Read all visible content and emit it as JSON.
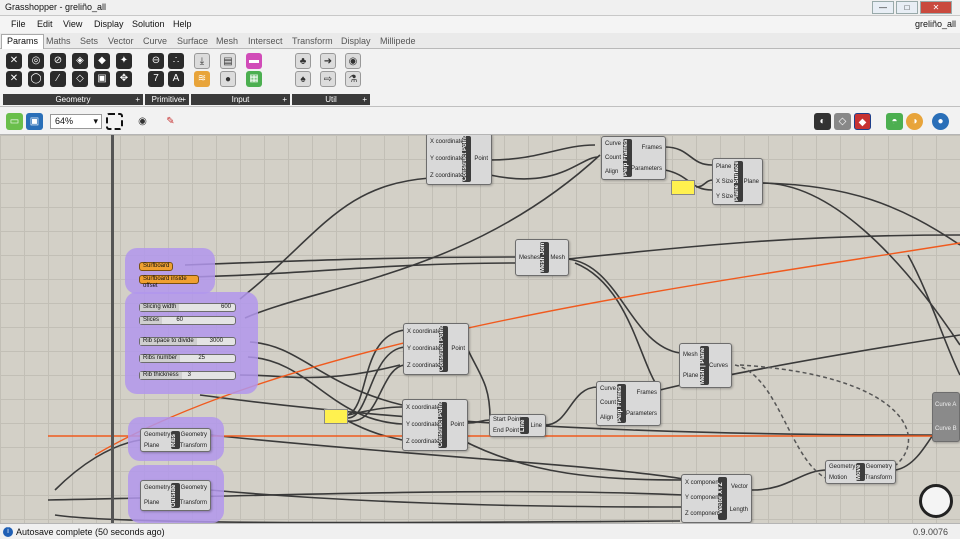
{
  "window": {
    "title": "Grasshopper - greliño_all",
    "minimize": "—",
    "maximize": "□",
    "close": "✕"
  },
  "menu": {
    "items": [
      "File",
      "Edit",
      "View",
      "Display",
      "Solution",
      "Help"
    ],
    "doc_name": "greliño_all"
  },
  "tabs": [
    "Params",
    "Maths",
    "Sets",
    "Vector",
    "Curve",
    "Surface",
    "Mesh",
    "Intersect",
    "Transform",
    "Display",
    "Millipede"
  ],
  "ribbon": {
    "groups": [
      {
        "label": "Geometry",
        "icon": "geometry-params-icons"
      },
      {
        "label": "Primitive",
        "icon": "primitive-params-icons"
      },
      {
        "label": "Input",
        "icon": "input-params-icons"
      },
      {
        "label": "Util",
        "icon": "util-params-icons"
      }
    ]
  },
  "toolbar": {
    "zoom": "64%"
  },
  "canvas": {
    "groups": [
      {
        "params": [
          "Surfboard",
          "Surfboard inside offset"
        ]
      },
      {
        "params": []
      }
    ],
    "sliders": [
      {
        "label": "Slicing width",
        "value": "600"
      },
      {
        "label": "Slices",
        "value": "60"
      },
      {
        "label": "Rib space to divide",
        "value": "3000"
      },
      {
        "label": "Ribs number",
        "value": "25"
      },
      {
        "label": "Rib thickness",
        "value": "3"
      }
    ],
    "components": [
      {
        "name": "Construct Point",
        "inputs": [
          "X coordinate",
          "Y coordinate",
          "Z coordinate"
        ],
        "outputs": [
          "Point"
        ]
      },
      {
        "name": "Perp Frames",
        "inputs": [
          "Curve",
          "Count",
          "Align"
        ],
        "outputs": [
          "Frames",
          "Parameters"
        ]
      },
      {
        "name": "Plane Surface",
        "inputs": [
          "Plane",
          "X Size",
          "Y Size"
        ],
        "outputs": [
          "Plane"
        ]
      },
      {
        "name": "Mesh Join",
        "inputs": [
          "Meshes"
        ],
        "outputs": [
          "Mesh"
        ]
      },
      {
        "name": "Construct Point",
        "inputs": [
          "X coordinate",
          "Y coordinate",
          "Z coordinate"
        ],
        "outputs": [
          "Point"
        ]
      },
      {
        "name": "Mesh | Plane",
        "inputs": [
          "Mesh",
          "Plane"
        ],
        "outputs": [
          "Curves"
        ]
      },
      {
        "name": "Construct Point",
        "inputs": [
          "X coordinate",
          "Y coordinate",
          "Z coordinate"
        ],
        "outputs": [
          "Point"
        ]
      },
      {
        "name": "Line",
        "inputs": [
          "Start Point",
          "End Point"
        ],
        "outputs": [
          "Line"
        ]
      },
      {
        "name": "Perp Frames",
        "inputs": [
          "Curve",
          "Count",
          "Align"
        ],
        "outputs": [
          "Frames",
          "Parameters"
        ]
      },
      {
        "name": "Ribs",
        "inputs": [
          "Geometry",
          "Plane"
        ],
        "outputs": [
          "Geometry",
          "Transform"
        ]
      },
      {
        "name": "Outside",
        "inputs": [
          "Geometry",
          "Plane"
        ],
        "outputs": [
          "Geometry",
          "Transform"
        ]
      },
      {
        "name": "Move",
        "inputs": [
          "Geometry",
          "Motion"
        ],
        "outputs": [
          "Geometry",
          "Transform"
        ]
      },
      {
        "name": "Vector XYZ",
        "inputs": [
          "X component",
          "Y component",
          "Z component"
        ],
        "outputs": [
          "Vector",
          "Length"
        ]
      }
    ],
    "curve_params": [
      "Curve A",
      "Curve B"
    ]
  },
  "status": {
    "message": "Autosave complete (50 seconds ago)",
    "version": "0.9.0076"
  },
  "colors": {
    "group": "#b296ec",
    "wire_selected": "#f05a1e",
    "panel": "#fff14f",
    "param_orange": "#f0a030"
  }
}
